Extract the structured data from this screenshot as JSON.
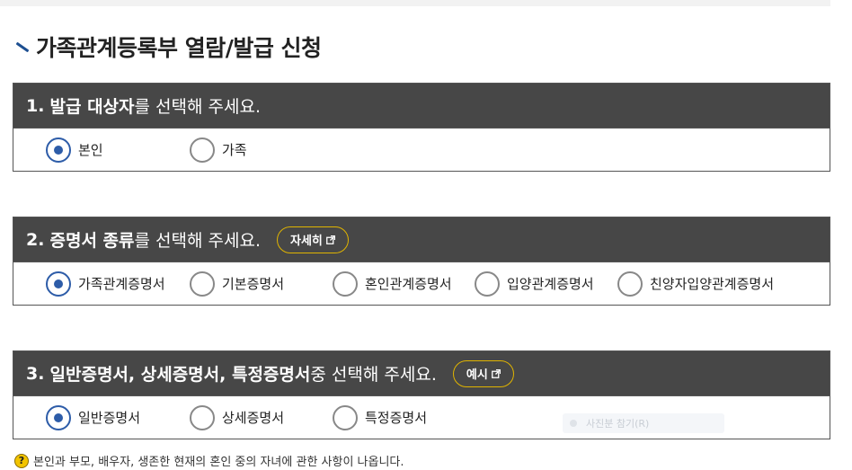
{
  "page": {
    "title": "가족관계등록부 열람/발급 신청"
  },
  "section1": {
    "number": "1.",
    "strong": "발급 대상자",
    "rest": "를 선택해 주세요.",
    "options": [
      {
        "label": "본인",
        "checked": true
      },
      {
        "label": "가족",
        "checked": false
      }
    ]
  },
  "section2": {
    "number": "2.",
    "strong": "증명서 종류",
    "rest": "를 선택해 주세요.",
    "button": "자세히",
    "options": [
      {
        "label": "가족관계증명서",
        "checked": true
      },
      {
        "label": "기본증명서",
        "checked": false
      },
      {
        "label": "혼인관계증명서",
        "checked": false
      },
      {
        "label": "입양관계증명서",
        "checked": false
      },
      {
        "label": "친양자입양관계증명서",
        "checked": false
      }
    ]
  },
  "section3": {
    "number": "3.",
    "strong": "일반증명서, 상세증명서, 특정증명서",
    "rest": " 중 선택해 주세요.",
    "button": "예시",
    "options": [
      {
        "label": "일반증명서",
        "checked": true
      },
      {
        "label": "상세증명서",
        "checked": false
      },
      {
        "label": "특정증명서",
        "checked": false
      }
    ],
    "ghost_text": "사진분 참기(R)"
  },
  "notice": {
    "icon": "question-icon",
    "text": "본인과 부모, 배우자, 생존한 현재의 혼인 중의 자녀에 관한 사항이 나옵니다."
  },
  "colors": {
    "header_bg": "#474747",
    "accent": "#2d5ca8",
    "button_border": "#e0b400"
  }
}
